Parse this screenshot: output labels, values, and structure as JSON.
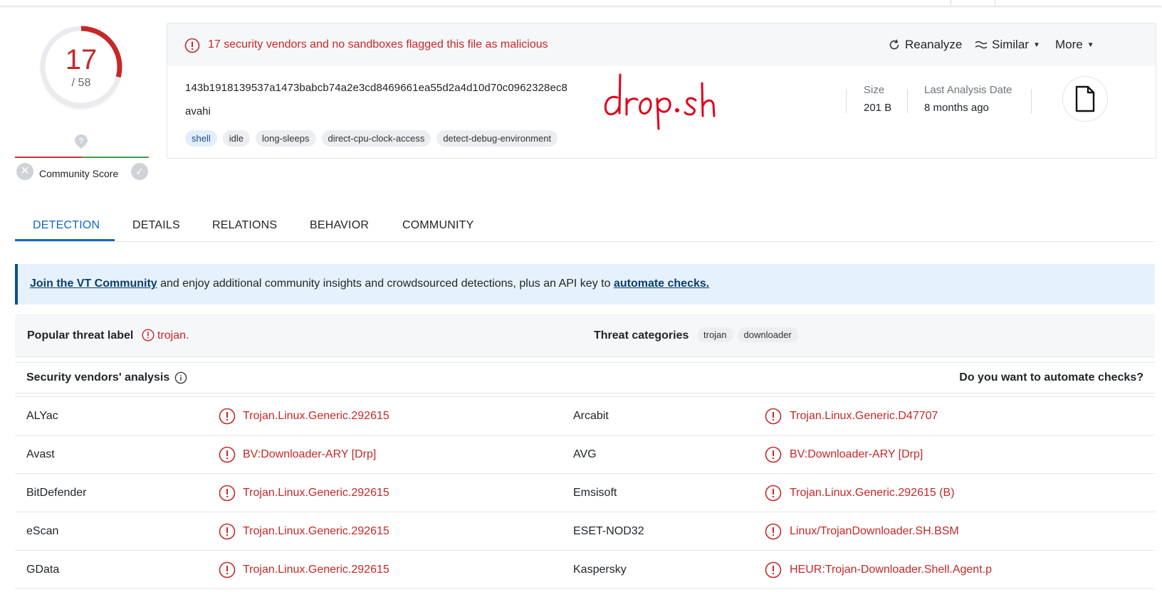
{
  "score": {
    "detections": "17",
    "total": "/ 58"
  },
  "community": {
    "label": "Community Score"
  },
  "alert": {
    "text": "17 security vendors and no sandboxes flagged this file as malicious"
  },
  "actions": {
    "reanalyze": "Reanalyze",
    "similar": "Similar",
    "more": "More"
  },
  "file": {
    "hash": "143b1918139537a1473babcb74a2e3cd8469661ea55d2a4d10d70c0962328ec8",
    "name": "avahi",
    "tags": [
      "shell",
      "idle",
      "long-sleeps",
      "direct-cpu-clock-access",
      "detect-debug-environment"
    ],
    "size_label": "Size",
    "size_value": "201 B",
    "date_label": "Last Analysis Date",
    "date_value": "8 months ago"
  },
  "annotation": {
    "handwritten": "drop.sh"
  },
  "tabs": [
    "DETECTION",
    "DETAILS",
    "RELATIONS",
    "BEHAVIOR",
    "COMMUNITY"
  ],
  "banner": {
    "link1": "Join the VT Community",
    "middle": " and enjoy additional community insights and crowdsourced detections, plus an API key to ",
    "link2": "automate checks."
  },
  "threat": {
    "popular_label": "Popular threat label",
    "popular_value": "trojan.",
    "categories_label": "Threat categories",
    "categories": [
      "trojan",
      "downloader"
    ]
  },
  "vendors_header": {
    "title": "Security vendors' analysis",
    "automate": "Do you want to automate checks?"
  },
  "vendors": [
    {
      "left_name": "ALYac",
      "left_result": "Trojan.Linux.Generic.292615",
      "right_name": "Arcabit",
      "right_result": "Trojan.Linux.Generic.D47707"
    },
    {
      "left_name": "Avast",
      "left_result": "BV:Downloader-ARY [Drp]",
      "right_name": "AVG",
      "right_result": "BV:Downloader-ARY [Drp]"
    },
    {
      "left_name": "BitDefender",
      "left_result": "Trojan.Linux.Generic.292615",
      "right_name": "Emsisoft",
      "right_result": "Trojan.Linux.Generic.292615 (B)"
    },
    {
      "left_name": "eScan",
      "left_result": "Trojan.Linux.Generic.292615",
      "right_name": "ESET-NOD32",
      "right_result": "Linux/TrojanDownloader.SH.BSM"
    },
    {
      "left_name": "GData",
      "left_result": "Trojan.Linux.Generic.292615",
      "right_name": "Kaspersky",
      "right_result": "HEUR:Trojan-Downloader.Shell.Agent.p"
    }
  ],
  "colors": {
    "malicious": "#c62828",
    "accent": "#1565c0",
    "banner_bg": "#e6f2fb"
  }
}
